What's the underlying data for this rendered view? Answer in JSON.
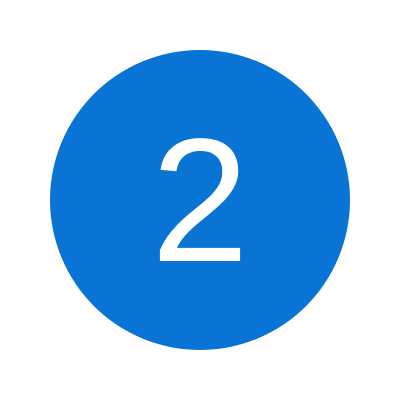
{
  "badge": {
    "value": "2",
    "background_color": "#0a74d4",
    "text_color": "#ffffff"
  }
}
